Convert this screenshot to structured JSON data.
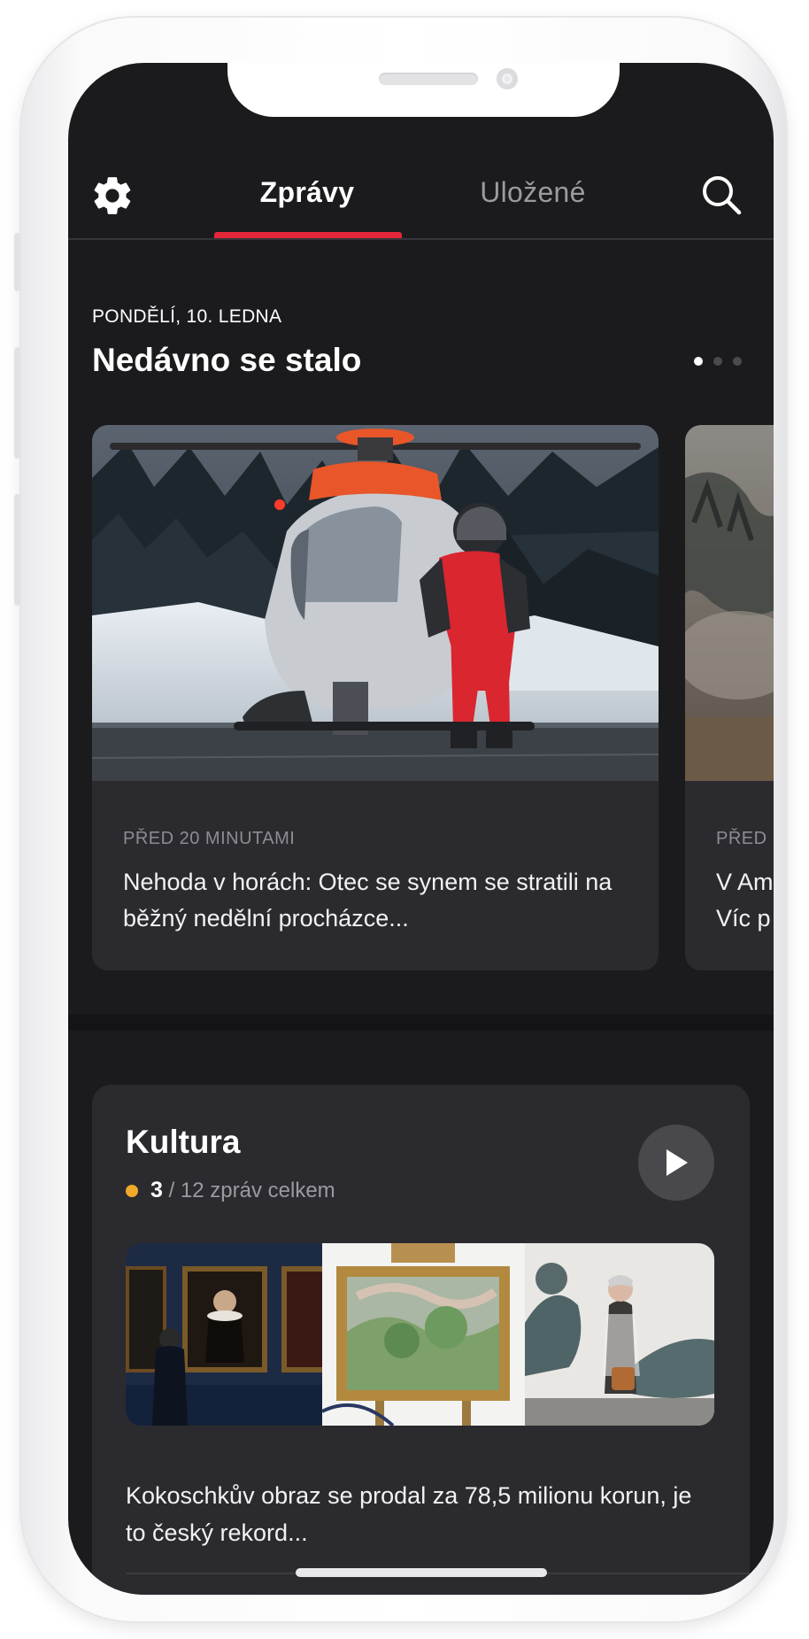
{
  "header": {
    "settings_icon": "gear-icon",
    "search_icon": "search-icon",
    "tabs": [
      {
        "label": "Zprávy",
        "active": true
      },
      {
        "label": "Uložené",
        "active": false
      }
    ],
    "accent_color": "#e3263a"
  },
  "recent": {
    "date": "PONDĚLÍ, 10. LEDNA",
    "title": "Nedávno se stalo",
    "pager_total": 3,
    "pager_active": 1,
    "cards": [
      {
        "time": "PŘED 20 MINUTAMI",
        "text": "Nehoda v horách: Otec se synem se stratili na běžný nedělní procházce..."
      },
      {
        "time": "PŘED",
        "text_line1": "V Am",
        "text_line2": "Víc p"
      }
    ]
  },
  "culture": {
    "title": "Kultura",
    "count_current": "3",
    "count_rest": "/ 12 zpráv celkem",
    "count_dot_color": "#f0a92a",
    "play_icon": "play-icon",
    "text": "Kokoschkův obraz se prodal za 78,5 milionu korun, je to český rekord..."
  }
}
